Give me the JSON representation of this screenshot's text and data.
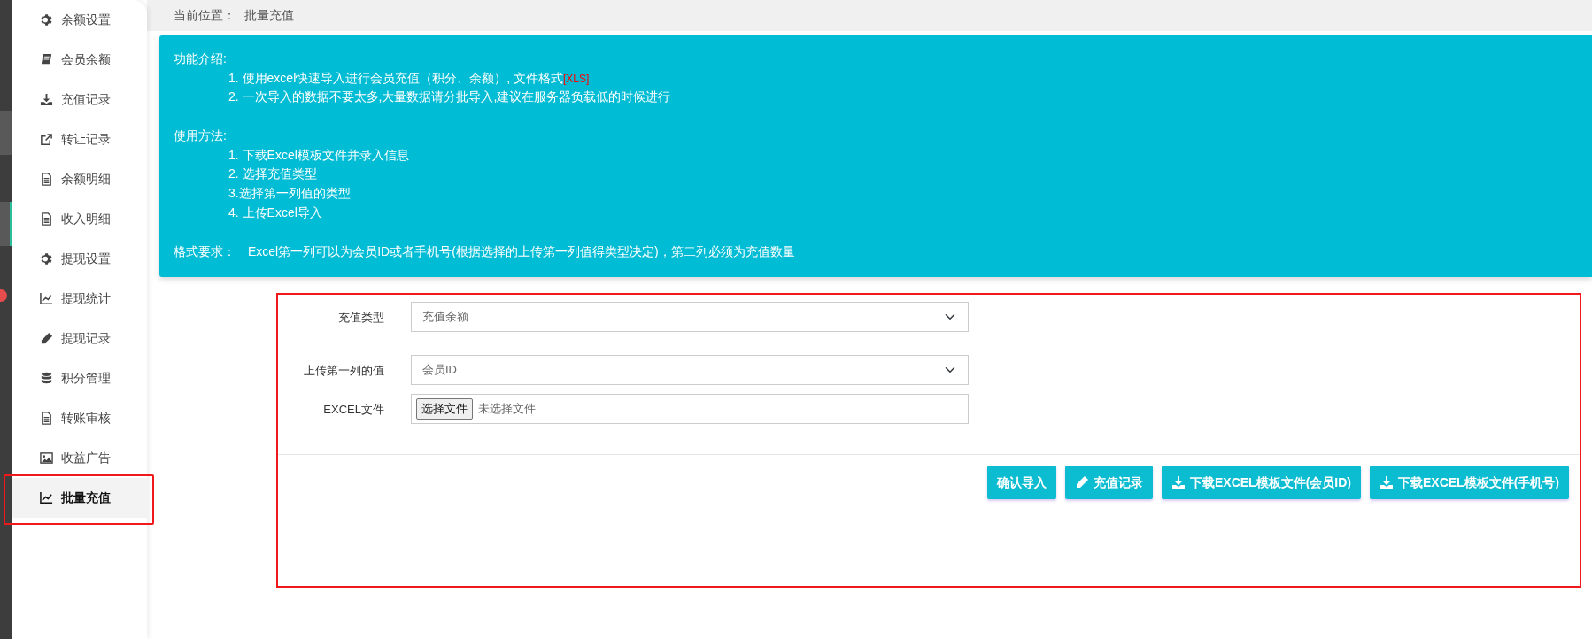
{
  "left_rail": {
    "badge_dot": true
  },
  "sidebar": {
    "items": [
      {
        "label": "余额设置",
        "kind": "gear",
        "selected": false,
        "highlighted": false
      },
      {
        "label": "会员余额",
        "kind": "book",
        "selected": false,
        "highlighted": false
      },
      {
        "label": "充值记录",
        "kind": "download",
        "selected": false,
        "highlighted": false
      },
      {
        "label": "转让记录",
        "kind": "share",
        "selected": false,
        "highlighted": false
      },
      {
        "label": "余额明细",
        "kind": "document",
        "selected": false,
        "highlighted": false
      },
      {
        "label": "收入明细",
        "kind": "document",
        "selected": false,
        "highlighted": false
      },
      {
        "label": "提现设置",
        "kind": "gear",
        "selected": false,
        "highlighted": false
      },
      {
        "label": "提现统计",
        "kind": "chart",
        "selected": false,
        "highlighted": false
      },
      {
        "label": "提现记录",
        "kind": "pencil",
        "selected": false,
        "highlighted": false
      },
      {
        "label": "积分管理",
        "kind": "database",
        "selected": false,
        "highlighted": false
      },
      {
        "label": "转账审核",
        "kind": "document",
        "selected": false,
        "highlighted": false
      },
      {
        "label": "收益广告",
        "kind": "image",
        "selected": false,
        "highlighted": false
      },
      {
        "label": "批量充值",
        "kind": "chart",
        "selected": true,
        "highlighted": true
      }
    ]
  },
  "breadcrumb": {
    "label": "当前位置：",
    "current": "批量充值"
  },
  "info_box": {
    "sections": [
      {
        "heading": "功能介绍:",
        "lines": [
          {
            "text": "1. 使用excel快速导入进行会员充值（积分、余额）, 文件格式",
            "note": "[XLS]"
          },
          {
            "text": "2. 一次导入的数据不要太多,大量数据请分批导入,建议在服务器负载低的时候进行"
          }
        ]
      },
      {
        "heading": "使用方法:",
        "lines": [
          {
            "text": "1. 下载Excel模板文件并录入信息"
          },
          {
            "text": "2. 选择充值类型"
          },
          {
            "text": "3.选择第一列值的类型"
          },
          {
            "text": "4. 上传Excel导入"
          }
        ]
      }
    ],
    "format": {
      "label": "格式要求：",
      "text": "Excel第一列可以为会员ID或者手机号(根据选择的上传第一列值得类型决定)，第二列必须为充值数量"
    }
  },
  "form": {
    "highlighted": true,
    "fields": [
      {
        "label": "充值类型",
        "kind": "select",
        "value": "充值余额"
      },
      {
        "label": "上传第一列的值",
        "kind": "select",
        "value": "会员ID"
      },
      {
        "label": "EXCEL文件",
        "kind": "file",
        "button": "选择文件",
        "value": "未选择文件"
      }
    ],
    "buttons": [
      {
        "label": "确认导入",
        "kind": "plain"
      },
      {
        "label": "充值记录",
        "kind": "edit"
      },
      {
        "label": "下载EXCEL模板文件(会员ID)",
        "kind": "download"
      },
      {
        "label": "下载EXCEL模板文件(手机号)",
        "kind": "download"
      }
    ]
  }
}
